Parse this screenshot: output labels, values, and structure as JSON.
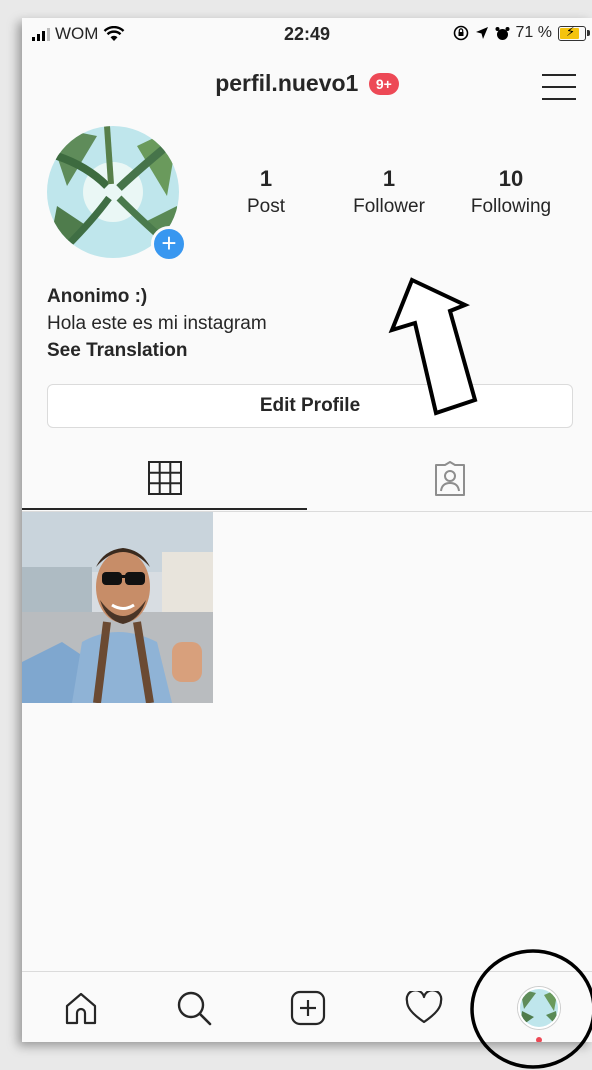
{
  "status_bar": {
    "carrier": "WOM",
    "time": "22:49",
    "battery_percent": "71 %"
  },
  "header": {
    "username": "perfil.nuevo1",
    "notification_badge": "9+"
  },
  "stats": {
    "posts": {
      "count": "1",
      "label": "Post"
    },
    "followers": {
      "count": "1",
      "label": "Follower"
    },
    "following": {
      "count": "10",
      "label": "Following"
    }
  },
  "bio": {
    "name": "Anonimo :)",
    "text": "Hola este es mi instagram",
    "translate_link": "See Translation"
  },
  "edit_profile_label": "Edit Profile",
  "tabs": [
    {
      "icon": "grid-icon",
      "active": true
    },
    {
      "icon": "tagged-icon",
      "active": false
    }
  ],
  "posts": [
    {
      "type": "photo"
    }
  ],
  "bottom_nav": [
    "home-icon",
    "search-icon",
    "add-post-icon",
    "activity-icon",
    "profile-avatar"
  ],
  "colors": {
    "accent_blue": "#3897f0",
    "badge_red": "#ed4956",
    "border": "#dbdbdb",
    "text": "#262626"
  }
}
